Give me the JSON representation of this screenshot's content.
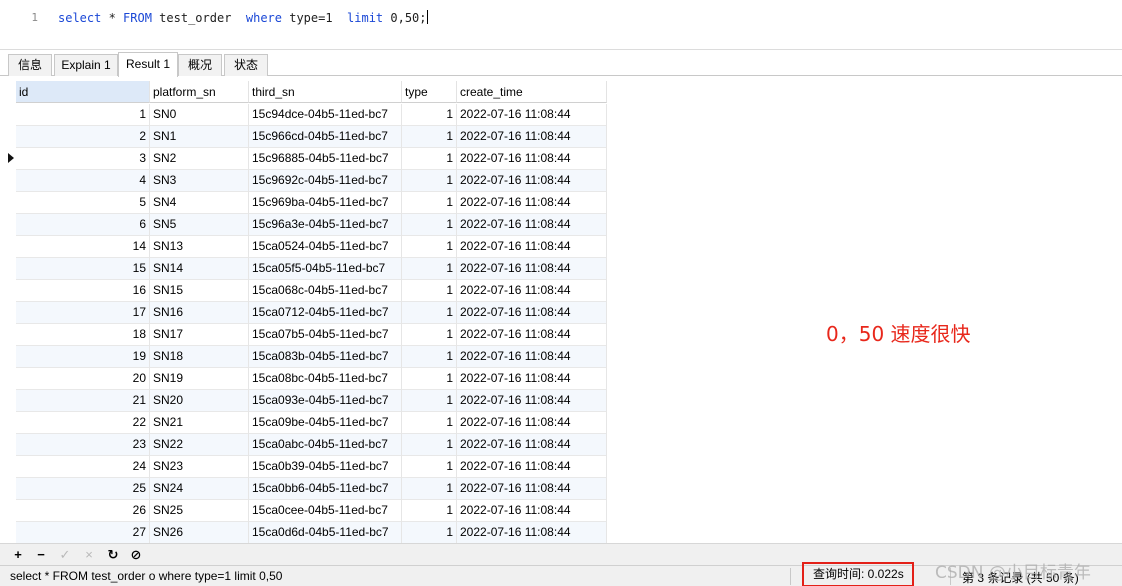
{
  "editor": {
    "line_number": "1",
    "sql": {
      "t1": "select",
      "t2": " * ",
      "t3": "FROM",
      "t4": " test_order  ",
      "t5": "where",
      "t6": " type=1  ",
      "t7": "limit",
      "t8": " 0,50;"
    }
  },
  "tabs": [
    {
      "label": "信息"
    },
    {
      "label": "Explain 1"
    },
    {
      "label": "Result 1"
    },
    {
      "label": "概况"
    },
    {
      "label": "状态"
    }
  ],
  "columns": [
    "id",
    "platform_sn",
    "third_sn",
    "type",
    "create_time"
  ],
  "rows": [
    {
      "id": "1",
      "platform_sn": "SN0",
      "third_sn": "15c94dce-04b5-11ed-bc7",
      "type": "1",
      "create_time": "2022-07-16 11:08:44"
    },
    {
      "id": "2",
      "platform_sn": "SN1",
      "third_sn": "15c966cd-04b5-11ed-bc7",
      "type": "1",
      "create_time": "2022-07-16 11:08:44"
    },
    {
      "id": "3",
      "platform_sn": "SN2",
      "third_sn": "15c96885-04b5-11ed-bc7",
      "type": "1",
      "create_time": "2022-07-16 11:08:44"
    },
    {
      "id": "4",
      "platform_sn": "SN3",
      "third_sn": "15c9692c-04b5-11ed-bc7",
      "type": "1",
      "create_time": "2022-07-16 11:08:44"
    },
    {
      "id": "5",
      "platform_sn": "SN4",
      "third_sn": "15c969ba-04b5-11ed-bc7",
      "type": "1",
      "create_time": "2022-07-16 11:08:44"
    },
    {
      "id": "6",
      "platform_sn": "SN5",
      "third_sn": "15c96a3e-04b5-11ed-bc7",
      "type": "1",
      "create_time": "2022-07-16 11:08:44"
    },
    {
      "id": "14",
      "platform_sn": "SN13",
      "third_sn": "15ca0524-04b5-11ed-bc7",
      "type": "1",
      "create_time": "2022-07-16 11:08:44"
    },
    {
      "id": "15",
      "platform_sn": "SN14",
      "third_sn": "15ca05f5-04b5-11ed-bc7",
      "type": "1",
      "create_time": "2022-07-16 11:08:44"
    },
    {
      "id": "16",
      "platform_sn": "SN15",
      "third_sn": "15ca068c-04b5-11ed-bc7",
      "type": "1",
      "create_time": "2022-07-16 11:08:44"
    },
    {
      "id": "17",
      "platform_sn": "SN16",
      "third_sn": "15ca0712-04b5-11ed-bc7",
      "type": "1",
      "create_time": "2022-07-16 11:08:44"
    },
    {
      "id": "18",
      "platform_sn": "SN17",
      "third_sn": "15ca07b5-04b5-11ed-bc7",
      "type": "1",
      "create_time": "2022-07-16 11:08:44"
    },
    {
      "id": "19",
      "platform_sn": "SN18",
      "third_sn": "15ca083b-04b5-11ed-bc7",
      "type": "1",
      "create_time": "2022-07-16 11:08:44"
    },
    {
      "id": "20",
      "platform_sn": "SN19",
      "third_sn": "15ca08bc-04b5-11ed-bc7",
      "type": "1",
      "create_time": "2022-07-16 11:08:44"
    },
    {
      "id": "21",
      "platform_sn": "SN20",
      "third_sn": "15ca093e-04b5-11ed-bc7",
      "type": "1",
      "create_time": "2022-07-16 11:08:44"
    },
    {
      "id": "22",
      "platform_sn": "SN21",
      "third_sn": "15ca09be-04b5-11ed-bc7",
      "type": "1",
      "create_time": "2022-07-16 11:08:44"
    },
    {
      "id": "23",
      "platform_sn": "SN22",
      "third_sn": "15ca0abc-04b5-11ed-bc7",
      "type": "1",
      "create_time": "2022-07-16 11:08:44"
    },
    {
      "id": "24",
      "platform_sn": "SN23",
      "third_sn": "15ca0b39-04b5-11ed-bc7",
      "type": "1",
      "create_time": "2022-07-16 11:08:44"
    },
    {
      "id": "25",
      "platform_sn": "SN24",
      "third_sn": "15ca0bb6-04b5-11ed-bc7",
      "type": "1",
      "create_time": "2022-07-16 11:08:44"
    },
    {
      "id": "26",
      "platform_sn": "SN25",
      "third_sn": "15ca0cee-04b5-11ed-bc7",
      "type": "1",
      "create_time": "2022-07-16 11:08:44"
    },
    {
      "id": "27",
      "platform_sn": "SN26",
      "third_sn": "15ca0d6d-04b5-11ed-bc7",
      "type": "1",
      "create_time": "2022-07-16 11:08:44"
    }
  ],
  "annotation": "0，50 速度很快",
  "toolbar": {
    "add": "+",
    "delete": "−",
    "apply": "✓",
    "cancel": "×",
    "refresh": "↻",
    "stop": "⊘"
  },
  "status": {
    "sql": "select * FROM test_order o where type=1  limit 0,50",
    "query_time": "查询时间: 0.022s",
    "record_info": "第 3 条记录 (共 50 条)",
    "watermark": "CSDN @小目标青年"
  },
  "colors": {
    "keyword": "#1a47d6",
    "annotation": "#e8271b",
    "highlight_box": "#e32018",
    "selected_header": "#dde9f8"
  }
}
